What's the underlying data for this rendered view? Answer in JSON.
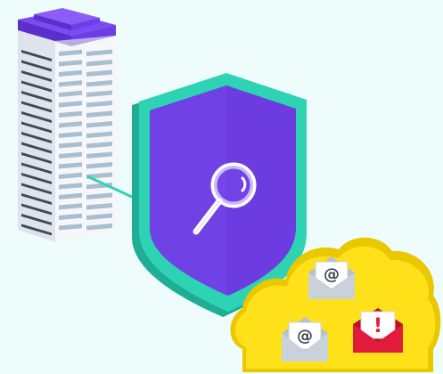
{
  "scene": {
    "description_free": true,
    "icons": {
      "building": "office-building-icon",
      "shield": "security-shield-icon",
      "magnifier": "magnifying-glass-icon",
      "cloud": "cloud-icon",
      "email": "email-envelope-icon",
      "alert_email": "alert-envelope-icon"
    },
    "email_symbol": "@",
    "alert_symbol": "!"
  },
  "colors": {
    "background": "#eefcfb",
    "shield_outer": "#2ed3b4",
    "shield_inner": "#6c3ce0",
    "building_roof": "#6d3de8",
    "building_wall": "#f2f4f8",
    "window": "#9fb7c8",
    "cloud": "#ffe11a",
    "envelope": "#c9d1da",
    "alert_envelope": "#e21b3c",
    "connector": "#2ed3b4"
  }
}
